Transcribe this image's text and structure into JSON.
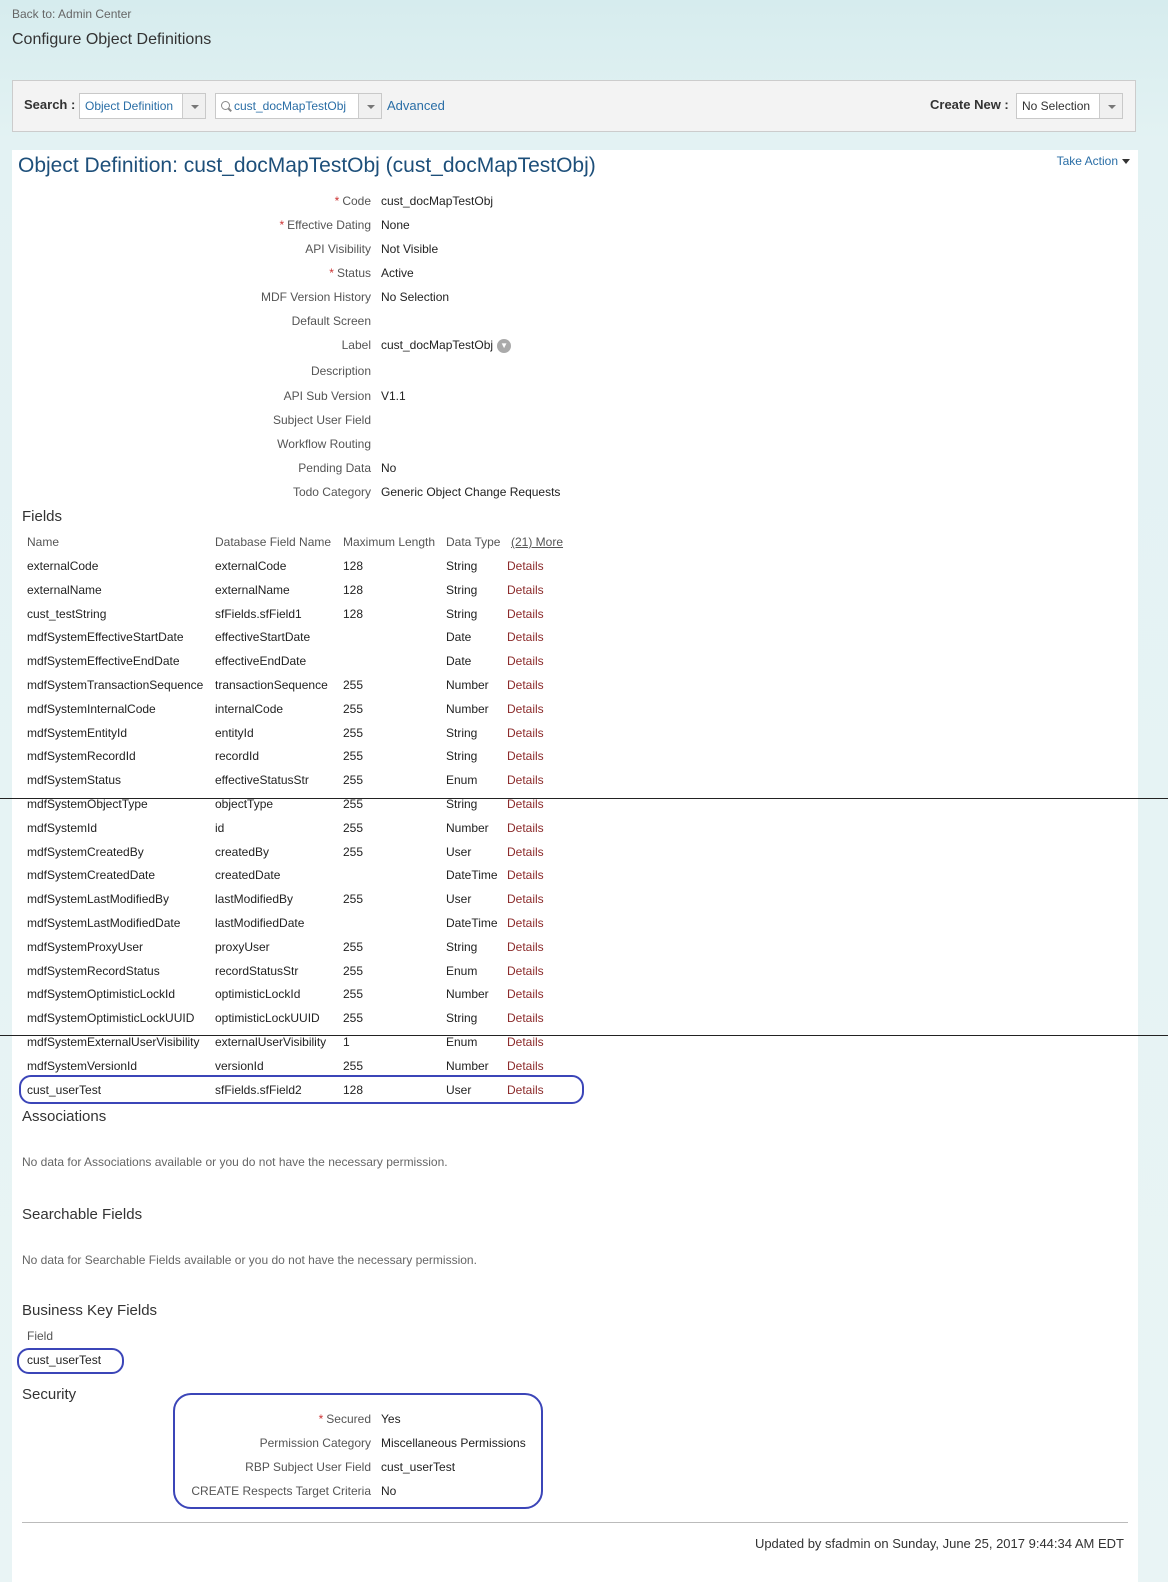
{
  "nav": {
    "back": "Back to: Admin Center",
    "page_title": "Configure Object Definitions"
  },
  "search": {
    "label": "Search :",
    "type_value": "Object Definition",
    "query_value": "cust_docMapTestObj",
    "advanced": "Advanced",
    "create_label": "Create New :",
    "create_value": "No Selection"
  },
  "object": {
    "title": "Object Definition: cust_docMapTestObj (cust_docMapTestObj)",
    "take_action": "Take Action",
    "properties": [
      {
        "label": "Code",
        "value": "cust_docMapTestObj",
        "required": true
      },
      {
        "label": "Effective Dating",
        "value": "None",
        "required": true
      },
      {
        "label": "API Visibility",
        "value": "Not Visible",
        "required": false
      },
      {
        "label": "Status",
        "value": "Active",
        "required": true
      },
      {
        "label": "MDF Version History",
        "value": "No Selection",
        "required": false
      },
      {
        "label": "Default Screen",
        "value": "",
        "required": false
      },
      {
        "label": "Label",
        "value": "cust_docMapTestObj",
        "required": false
      },
      {
        "label": "Description",
        "value": "",
        "required": false
      },
      {
        "label": "API Sub Version",
        "value": "V1.1",
        "required": false
      },
      {
        "label": "Subject User Field",
        "value": "",
        "required": false
      },
      {
        "label": "Workflow Routing",
        "value": "",
        "required": false
      },
      {
        "label": "Pending Data",
        "value": "No",
        "required": false
      },
      {
        "label": "Todo Category",
        "value": "Generic Object Change Requests",
        "required": false
      }
    ]
  },
  "fields": {
    "heading": "Fields",
    "columns": [
      "Name",
      "Database Field Name",
      "Maximum Length",
      "Data Type",
      "(21) More"
    ],
    "details_label": "Details",
    "rows": [
      [
        "externalCode",
        "externalCode",
        "128",
        "String"
      ],
      [
        "externalName",
        "externalName",
        "128",
        "String"
      ],
      [
        "cust_testString",
        "sfFields.sfField1",
        "128",
        "String"
      ],
      [
        "mdfSystemEffectiveStartDate",
        "effectiveStartDate",
        "",
        "Date"
      ],
      [
        "mdfSystemEffectiveEndDate",
        "effectiveEndDate",
        "",
        "Date"
      ],
      [
        "mdfSystemTransactionSequence",
        "transactionSequence",
        "255",
        "Number"
      ],
      [
        "mdfSystemInternalCode",
        "internalCode",
        "255",
        "Number"
      ],
      [
        "mdfSystemEntityId",
        "entityId",
        "255",
        "String"
      ],
      [
        "mdfSystemRecordId",
        "recordId",
        "255",
        "String"
      ],
      [
        "mdfSystemStatus",
        "effectiveStatusStr",
        "255",
        "Enum"
      ],
      [
        "mdfSystemObjectType",
        "objectType",
        "255",
        "String"
      ],
      [
        "mdfSystemId",
        "id",
        "255",
        "Number"
      ],
      [
        "mdfSystemCreatedBy",
        "createdBy",
        "255",
        "User"
      ],
      [
        "mdfSystemCreatedDate",
        "createdDate",
        "",
        "DateTime"
      ],
      [
        "mdfSystemLastModifiedBy",
        "lastModifiedBy",
        "255",
        "User"
      ],
      [
        "mdfSystemLastModifiedDate",
        "lastModifiedDate",
        "",
        "DateTime"
      ],
      [
        "mdfSystemProxyUser",
        "proxyUser",
        "255",
        "String"
      ],
      [
        "mdfSystemRecordStatus",
        "recordStatusStr",
        "255",
        "Enum"
      ],
      [
        "mdfSystemOptimisticLockId",
        "optimisticLockId",
        "255",
        "Number"
      ],
      [
        "mdfSystemOptimisticLockUUID",
        "optimisticLockUUID",
        "255",
        "String"
      ],
      [
        "mdfSystemExternalUserVisibility",
        "externalUserVisibility",
        "1",
        "Enum"
      ],
      [
        "mdfSystemVersionId",
        "versionId",
        "255",
        "Number"
      ],
      [
        "cust_userTest",
        "sfFields.sfField2",
        "128",
        "User"
      ]
    ]
  },
  "associations": {
    "heading": "Associations",
    "note": "No data for Associations available or you do not have the necessary permission."
  },
  "searchable": {
    "heading": "Searchable Fields",
    "note": "No data for Searchable Fields available or you do not have the necessary permission."
  },
  "business_key": {
    "heading": "Business Key Fields",
    "column": "Field",
    "value": "cust_userTest"
  },
  "security": {
    "heading": "Security",
    "properties": [
      {
        "label": "Secured",
        "value": "Yes",
        "required": true
      },
      {
        "label": "Permission Category",
        "value": "Miscellaneous Permissions",
        "required": false
      },
      {
        "label": "RBP Subject User Field",
        "value": "cust_userTest",
        "required": false
      },
      {
        "label": "CREATE Respects Target Criteria",
        "value": "No",
        "required": false
      }
    ]
  },
  "footer": {
    "updated": "Updated by sfadmin on Sunday, June 25, 2017 9:44:34 AM EDT"
  }
}
